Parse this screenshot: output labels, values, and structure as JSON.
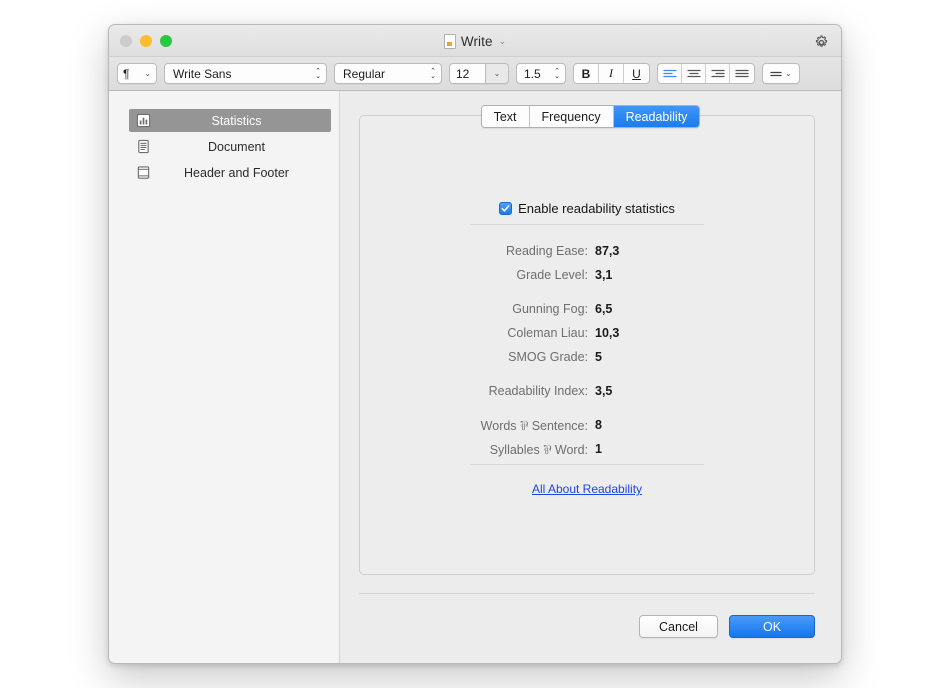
{
  "window": {
    "title": "Write",
    "title_chevron": "⌄",
    "doc_icon": "document-icon",
    "gear_icon": "gear-icon",
    "lights": {
      "close": "close-button",
      "minimize": "minimize-button",
      "maximize": "maximize-button"
    }
  },
  "toolbar": {
    "paragraph_glyph": "¶",
    "paragraph_chevron": "⌄",
    "font_family": "Write Sans",
    "font_style": "Regular",
    "font_size": "12",
    "line_spacing": "1.5",
    "bold_label": "B",
    "italic_label": "I",
    "underline_label": "U",
    "stepper_up": "⌃",
    "stepper_down": "⌄",
    "size_chevron": "⌄",
    "list_chevron": "⌄"
  },
  "sidebar": {
    "items": [
      {
        "label": "Statistics",
        "icon": "bar-chart-icon",
        "selected": true
      },
      {
        "label": "Document",
        "icon": "document-lines-icon",
        "selected": false
      },
      {
        "label": "Header and Footer",
        "icon": "header-footer-icon",
        "selected": false
      }
    ]
  },
  "tabs": [
    {
      "label": "Text",
      "active": false
    },
    {
      "label": "Frequency",
      "active": false
    },
    {
      "label": "Readability",
      "active": true
    }
  ],
  "checkbox": {
    "label": "Enable readability statistics",
    "checked": true,
    "check_glyph": "✓"
  },
  "stats": {
    "group1": [
      {
        "label": "Reading Ease:",
        "value": "87,3"
      },
      {
        "label": "Grade Level:",
        "value": "3,1"
      }
    ],
    "group2": [
      {
        "label": "Gunning Fog:",
        "value": "6,5"
      },
      {
        "label": "Coleman Liau:",
        "value": "10,3"
      },
      {
        "label": "SMOG Grade:",
        "value": "5"
      }
    ],
    "group3": [
      {
        "label": "Readability Index:",
        "value": "3,5"
      }
    ],
    "group4": [
      {
        "label": "Words ⅌ Sentence:",
        "value": "8"
      },
      {
        "label": "Syllables ⅌ Word:",
        "value": "1"
      }
    ]
  },
  "link": {
    "label": "All About Readability"
  },
  "footer": {
    "cancel_label": "Cancel",
    "ok_label": "OK"
  },
  "colors": {
    "accent": "#1a7cf0",
    "selected_row": "#959595",
    "link": "#1b47e8"
  }
}
